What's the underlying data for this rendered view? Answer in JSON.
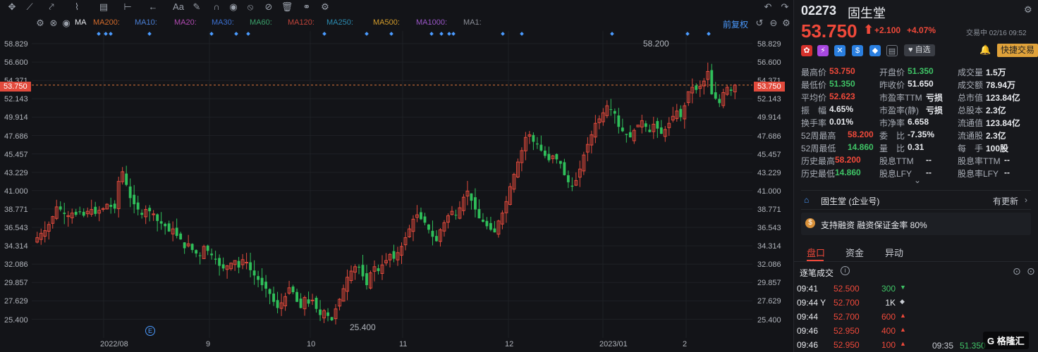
{
  "toolbar": {
    "icons": [
      "crosshair-icon",
      "line-tool-icon",
      "trend-tool-icon",
      "pattern-tool-icon",
      "fib-tool-icon",
      "measure-tool-icon",
      "arrow-tool-icon",
      "text-tool-icon",
      "brush-tool-icon",
      "magnet-icon",
      "eye-icon",
      "hide-icon",
      "trash-icon",
      "link-icon",
      "settings-icon"
    ],
    "text_tool_label": "Aa"
  },
  "indicators": {
    "main": "MA",
    "items": [
      {
        "label": "MA200:",
        "color": "#d26a2a"
      },
      {
        "label": "MA10:",
        "color": "#4a7fd4"
      },
      {
        "label": "MA20:",
        "color": "#b04ab0"
      },
      {
        "label": "MA30:",
        "color": "#3b6fcf"
      },
      {
        "label": "MA60:",
        "color": "#3aa06a"
      },
      {
        "label": "MA120:",
        "color": "#c0443a"
      },
      {
        "label": "MA250:",
        "color": "#2b8bb0"
      },
      {
        "label": "MA500:",
        "color": "#d29b2a"
      },
      {
        "label": "MA1000:",
        "color": "#9a56c8"
      },
      {
        "label": "MA1:",
        "color": "#8a8d95"
      }
    ],
    "adjust_label": "前复权"
  },
  "axis": {
    "y_ticks": [
      "58.829",
      "56.600",
      "54.371",
      "52.143",
      "49.914",
      "47.686",
      "45.457",
      "43.229",
      "41.000",
      "38.771",
      "36.543",
      "34.314",
      "32.086",
      "29.857",
      "27.629",
      "25.400"
    ],
    "x_ticks": [
      "2022/08",
      "9",
      "10",
      "11",
      "12",
      "2023/01",
      "2"
    ],
    "current_price": "53.750",
    "annotation_high": "58.200",
    "annotation_low": "25.400"
  },
  "chart_data": {
    "type": "candlestick",
    "ylim": [
      24.2,
      59.9
    ],
    "up_color": "#e24a3c",
    "down_color": "#2fbf5a",
    "closes": [
      36.4,
      36.9,
      37.2,
      37.9,
      38.8,
      39.9,
      39.6,
      39.1,
      38.9,
      39.2,
      39.0,
      39.3,
      38.9,
      39.4,
      39.6,
      39.1,
      39.5,
      39.7,
      40.2,
      39.9,
      39.7,
      42.8,
      43.9,
      42.4,
      40.9,
      40.2,
      39.6,
      39.0,
      39.6,
      39.4,
      39.1,
      38.3,
      38.0,
      37.7,
      37.1,
      37.4,
      36.6,
      36.2,
      35.2,
      35.7,
      35.0,
      34.6,
      34.3,
      35.4,
      34.9,
      34.4,
      33.9,
      33.2,
      32.9,
      33.2,
      33.5,
      33.8,
      33.0,
      33.9,
      33.6,
      32.7,
      32.1,
      31.6,
      31.0,
      30.6,
      30.0,
      29.1,
      28.4,
      29.0,
      29.7,
      30.7,
      30.2,
      29.1,
      28.4,
      29.6,
      28.9,
      29.3,
      28.3,
      27.6,
      28.1,
      27.5,
      27.0,
      28.3,
      29.4,
      30.6,
      31.9,
      32.6,
      33.1,
      33.0,
      32.0,
      31.0,
      32.4,
      33.1,
      32.6,
      33.3,
      33.8,
      34.5,
      34.0,
      34.7,
      35.4,
      36.4,
      37.4,
      38.5,
      39.0,
      38.5,
      38.1,
      37.3,
      36.5,
      36.0,
      37.3,
      38.1,
      38.9,
      39.4,
      39.0,
      39.8,
      41.0,
      41.7,
      40.6,
      39.6,
      38.6,
      38.2,
      37.7,
      37.3,
      37.0,
      38.3,
      39.2,
      40.5,
      42.2,
      43.6,
      45.0,
      46.3,
      47.8,
      48.1,
      47.3,
      47.0,
      46.3,
      45.7,
      45.2,
      45.7,
      45.3,
      44.8,
      43.5,
      42.7,
      42.2,
      42.9,
      44.2,
      45.8,
      47.0,
      48.1,
      49.4,
      49.9,
      50.6,
      51.4,
      51.0,
      50.5,
      49.0,
      48.5,
      48.1,
      47.8,
      48.6,
      49.2,
      49.7,
      49.0,
      48.4,
      49.3,
      48.8,
      48.2,
      48.7,
      49.4,
      50.2,
      50.8,
      50.1,
      51.4,
      53.0,
      53.5,
      53.2,
      53.6,
      54.2,
      55.3,
      52.7,
      52.2,
      51.7,
      52.9,
      53.5,
      53.1,
      53.75
    ],
    "highs_note": "approx OHLC derived from closes"
  },
  "panel": {
    "code": "02273",
    "name": "固生堂",
    "price": "53.750",
    "change": "+2.100",
    "change_pct": "+4.07%",
    "trade_time": "交易中 02/16 09:52",
    "watch_label": "自选",
    "trade_button": "快捷交易",
    "stats": [
      [
        {
          "k": "最高价",
          "v": "53.750",
          "c": "red"
        },
        {
          "k": "开盘价",
          "v": "51.350",
          "c": "green"
        },
        {
          "k": "成交量",
          "v": "1.5万",
          "c": "white"
        }
      ],
      [
        {
          "k": "最低价",
          "v": "51.350",
          "c": "green"
        },
        {
          "k": "昨收价",
          "v": "51.650",
          "c": "white"
        },
        {
          "k": "成交额",
          "v": "78.94万",
          "c": "white"
        }
      ],
      [
        {
          "k": "平均价",
          "v": "52.623",
          "c": "red"
        },
        {
          "k": "市盈率TTM",
          "v": "亏损",
          "c": "white"
        },
        {
          "k": "总市值",
          "v": "123.84亿",
          "c": "white"
        }
      ],
      [
        {
          "k": "振　幅",
          "v": "4.65%",
          "c": "white"
        },
        {
          "k": "市盈率(静)",
          "v": "亏损",
          "c": "white"
        },
        {
          "k": "总股本",
          "v": "2.3亿",
          "c": "white"
        }
      ],
      [
        {
          "k": "换手率",
          "v": "0.01%",
          "c": "white"
        },
        {
          "k": "市净率",
          "v": "6.658",
          "c": "white"
        },
        {
          "k": "流通值",
          "v": "123.84亿",
          "c": "white"
        }
      ],
      [
        {
          "k": "52周最高",
          "v": "58.200",
          "c": "red"
        },
        {
          "k": "委　比",
          "v": "-7.35%",
          "c": "white"
        },
        {
          "k": "流通股",
          "v": "2.3亿",
          "c": "white"
        }
      ],
      [
        {
          "k": "52周最低",
          "v": "14.860",
          "c": "green"
        },
        {
          "k": "量　比",
          "v": "0.31",
          "c": "white"
        },
        {
          "k": "每　手",
          "v": "100股",
          "c": "white"
        }
      ],
      [
        {
          "k": "历史最高",
          "v": "58.200",
          "c": "red"
        },
        {
          "k": "股息TTM",
          "v": "--",
          "c": "white"
        },
        {
          "k": "股息率TTM",
          "v": "--",
          "c": "white"
        }
      ],
      [
        {
          "k": "历史最低",
          "v": "14.860",
          "c": "green"
        },
        {
          "k": "股息LFY",
          "v": "--",
          "c": "white"
        },
        {
          "k": "股息率LFY",
          "v": "--",
          "c": "white"
        }
      ]
    ],
    "company_row": {
      "label": "固生堂 (企业号)",
      "update": "有更新"
    },
    "margin_row": {
      "label": "支持融资 融资保证金率 80%"
    },
    "tabs": [
      "盘口",
      "资金",
      "异动"
    ],
    "ticks_title": "逐笔成交",
    "ticks": [
      {
        "time": "09:41",
        "price": "52.500",
        "vol": "300",
        "dir": "down",
        "pc": "red",
        "vc": "green"
      },
      {
        "time": "09:44 Y",
        "price": "52.700",
        "vol": "1K",
        "dir": "neutral",
        "pc": "red",
        "vc": "white"
      },
      {
        "time": "09:44",
        "price": "52.700",
        "vol": "600",
        "dir": "up",
        "pc": "red",
        "vc": "red"
      },
      {
        "time": "09:46",
        "price": "52.950",
        "vol": "400",
        "dir": "up",
        "pc": "red",
        "vc": "red"
      },
      {
        "time": "09:46",
        "price": "52.950",
        "vol": "100",
        "dir": "up",
        "pc": "red",
        "vc": "red"
      }
    ],
    "extra_tick": {
      "time": "09:35",
      "price": "51.350",
      "vol": "300"
    },
    "brand": "格隆汇"
  }
}
